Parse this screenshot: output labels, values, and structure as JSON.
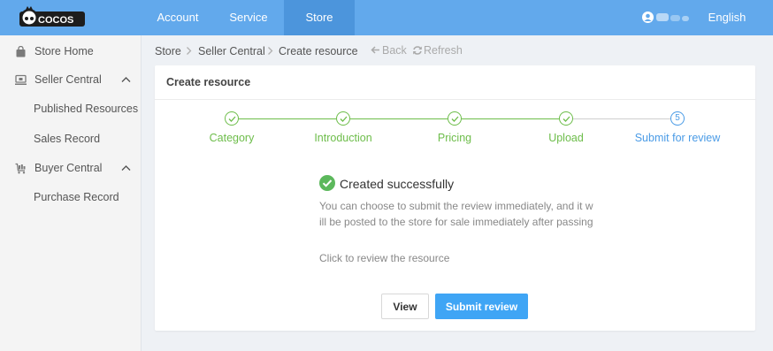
{
  "logo": {
    "text": "COCOS",
    "icon": "cocos-logo"
  },
  "nav": {
    "account": "Account",
    "service": "Service",
    "store": "Store",
    "language": "English"
  },
  "sidebar": {
    "store_home": "Store Home",
    "seller_central": "Seller Central",
    "published_resources": "Published Resources",
    "sales_record": "Sales Record",
    "buyer_central": "Buyer Central",
    "purchase_record": "Purchase Record"
  },
  "breadcrumb": {
    "items": [
      "Store",
      "Seller Central",
      "Create resource"
    ],
    "back": "Back",
    "refresh": "Refresh"
  },
  "panel": {
    "title": "Create resource",
    "steps": [
      {
        "label": "Category",
        "state": "done"
      },
      {
        "label": "Introduction",
        "state": "done"
      },
      {
        "label": "Pricing",
        "state": "done"
      },
      {
        "label": "Upload",
        "state": "done"
      },
      {
        "label": "Submit for review",
        "state": "active",
        "number": "5"
      }
    ],
    "success_title": "Created successfully",
    "description": "You can choose to submit the review immediately, and it will be posted to the store for sale immediately after passing",
    "review_link": "Click to review the resource",
    "view_button": "View",
    "submit_button": "Submit review"
  },
  "colors": {
    "nav_bg": "#62a9ec",
    "nav_active_bg": "#4c95dc",
    "step_done": "#6dbd4a",
    "step_active": "#4a9be6",
    "primary_button": "#3fa5f5"
  }
}
